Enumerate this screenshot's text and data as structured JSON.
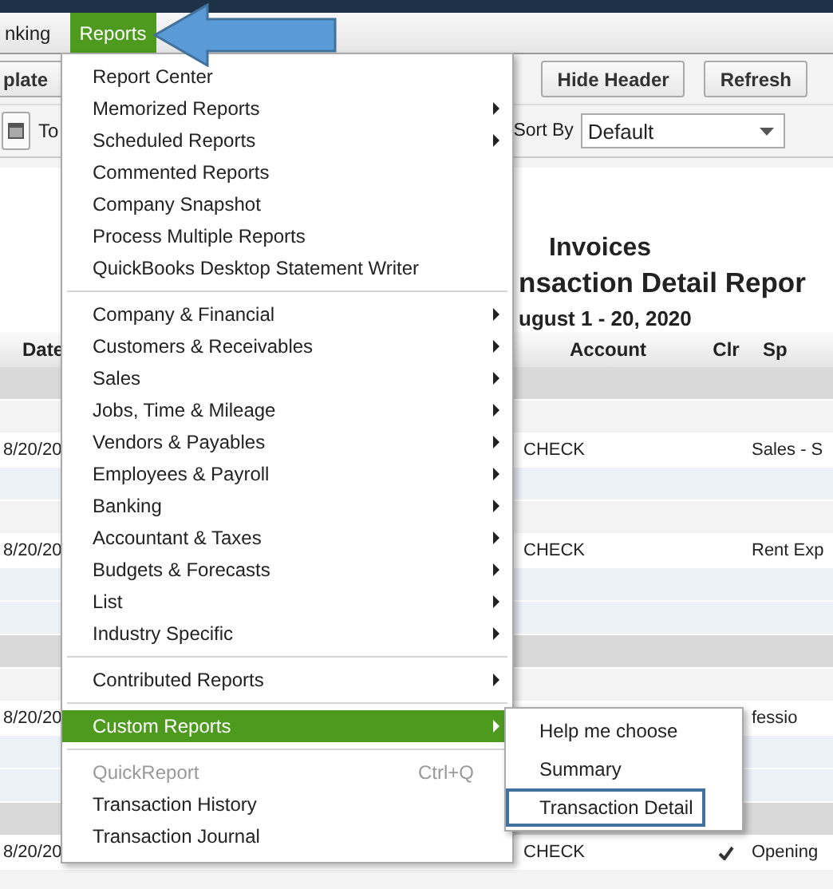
{
  "menubar": [
    {
      "label": "nking",
      "selected": false
    },
    {
      "label": "Reports",
      "selected": true
    }
  ],
  "toolbar": {
    "buttons": [
      "plate",
      "Hide Header",
      "Refresh"
    ]
  },
  "filters": {
    "to_label": "To",
    "sort_by_label": "Sort By",
    "sort_by_value": "Default"
  },
  "report": {
    "company": "Invoices",
    "title": "nsaction Detail Repor",
    "date_range": "ugust 1 - 20, 2020"
  },
  "table": {
    "columns": [
      "Date",
      "Account",
      "Clr",
      "Sp"
    ],
    "rows": [
      {
        "kind": "section"
      },
      {
        "kind": "light"
      },
      {
        "kind": "data",
        "date": "8/20/20",
        "account": "CHECK",
        "cleared": false,
        "split": "Sales - S"
      },
      {
        "kind": "blue"
      },
      {
        "kind": "light"
      },
      {
        "kind": "data",
        "date": "8/20/20",
        "account": "CHECK",
        "cleared": false,
        "split": "Rent Exp"
      },
      {
        "kind": "blue"
      },
      {
        "kind": "blue"
      },
      {
        "kind": "section"
      },
      {
        "kind": "light"
      },
      {
        "kind": "data",
        "date": "8/20/20",
        "cleared": false,
        "split": "fessio"
      },
      {
        "kind": "blue"
      },
      {
        "kind": "blue"
      },
      {
        "kind": "section"
      },
      {
        "kind": "data",
        "date": "8/20/20",
        "account": "CHECK",
        "cleared": true,
        "split": "Opening"
      },
      {
        "kind": "light"
      }
    ]
  },
  "menu": {
    "items": [
      {
        "kind": "item",
        "label": "Report Center",
        "submenu": false,
        "disabled": false,
        "selected": false
      },
      {
        "kind": "item",
        "label": "Memorized Reports",
        "submenu": true,
        "disabled": false,
        "selected": false
      },
      {
        "kind": "item",
        "label": "Scheduled Reports",
        "submenu": true,
        "disabled": false,
        "selected": false
      },
      {
        "kind": "item",
        "label": "Commented Reports",
        "submenu": false,
        "disabled": false,
        "selected": false
      },
      {
        "kind": "item",
        "label": "Company Snapshot",
        "submenu": false,
        "disabled": false,
        "selected": false
      },
      {
        "kind": "item",
        "label": "Process Multiple Reports",
        "submenu": false,
        "disabled": false,
        "selected": false
      },
      {
        "kind": "item",
        "label": "QuickBooks Desktop Statement Writer",
        "submenu": false,
        "disabled": false,
        "selected": false
      },
      {
        "kind": "separator"
      },
      {
        "kind": "item",
        "label": "Company & Financial",
        "submenu": true,
        "disabled": false,
        "selected": false
      },
      {
        "kind": "item",
        "label": "Customers & Receivables",
        "submenu": true,
        "disabled": false,
        "selected": false
      },
      {
        "kind": "item",
        "label": "Sales",
        "submenu": true,
        "disabled": false,
        "selected": false
      },
      {
        "kind": "item",
        "label": "Jobs, Time & Mileage",
        "submenu": true,
        "disabled": false,
        "selected": false
      },
      {
        "kind": "item",
        "label": "Vendors & Payables",
        "submenu": true,
        "disabled": false,
        "selected": false
      },
      {
        "kind": "item",
        "label": "Employees & Payroll",
        "submenu": true,
        "disabled": false,
        "selected": false
      },
      {
        "kind": "item",
        "label": "Banking",
        "submenu": true,
        "disabled": false,
        "selected": false
      },
      {
        "kind": "item",
        "label": "Accountant & Taxes",
        "submenu": true,
        "disabled": false,
        "selected": false
      },
      {
        "kind": "item",
        "label": "Budgets & Forecasts",
        "submenu": true,
        "disabled": false,
        "selected": false
      },
      {
        "kind": "item",
        "label": "List",
        "submenu": true,
        "disabled": false,
        "selected": false
      },
      {
        "kind": "item",
        "label": "Industry Specific",
        "submenu": true,
        "disabled": false,
        "selected": false
      },
      {
        "kind": "separator"
      },
      {
        "kind": "item",
        "label": "Contributed Reports",
        "submenu": true,
        "disabled": false,
        "selected": false
      },
      {
        "kind": "separator"
      },
      {
        "kind": "item",
        "label": "Custom Reports",
        "submenu": true,
        "disabled": false,
        "selected": true
      },
      {
        "kind": "separator"
      },
      {
        "kind": "item",
        "label": "QuickReport",
        "shortcut": "Ctrl+Q",
        "submenu": false,
        "disabled": true,
        "selected": false
      },
      {
        "kind": "item",
        "label": "Transaction History",
        "submenu": false,
        "disabled": false,
        "selected": false
      },
      {
        "kind": "item",
        "label": "Transaction Journal",
        "submenu": false,
        "disabled": false,
        "selected": false
      }
    ]
  },
  "submenu": {
    "items": [
      {
        "label": "Help me choose",
        "selected": false
      },
      {
        "label": "Summary",
        "selected": false
      },
      {
        "label": "Transaction Detail",
        "selected": true
      }
    ]
  }
}
